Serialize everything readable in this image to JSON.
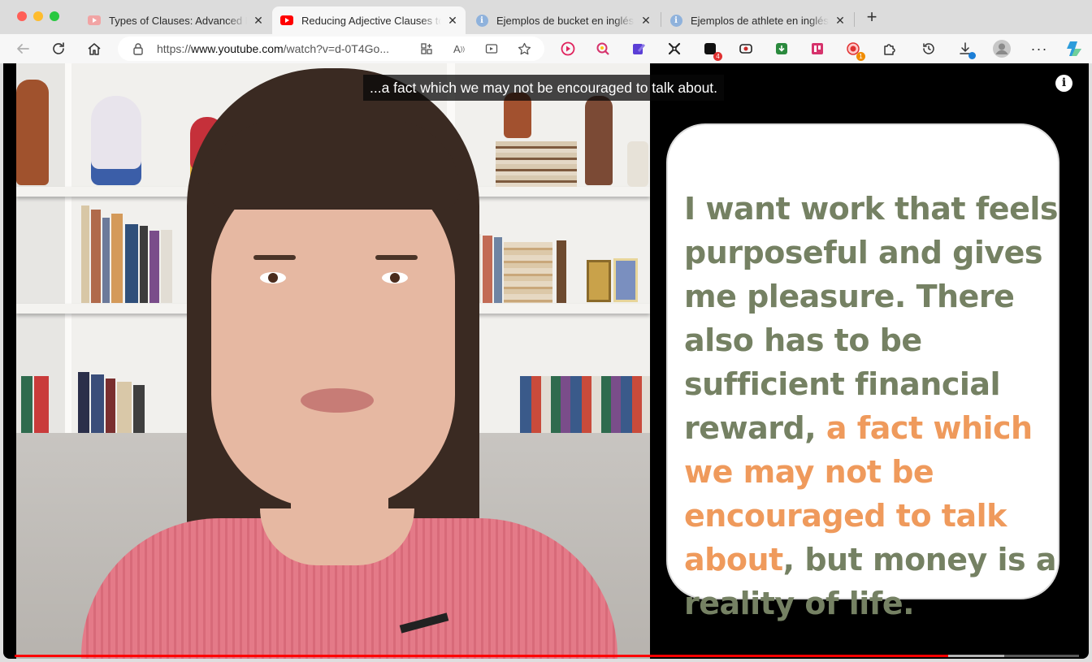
{
  "window": {
    "controls": [
      "close",
      "minimize",
      "maximize"
    ]
  },
  "tabs": [
    {
      "title": "Types of Clauses: Advanced Eng",
      "favicon": "youtube-icon",
      "favicon_color": "#f1a4a4",
      "active": false
    },
    {
      "title": "Reducing Adjective Clauses to Adjective Phrases",
      "favicon": "youtube-icon",
      "favicon_color": "#ff0000",
      "active": true
    },
    {
      "title": "Ejemplos de bucket en inglés | Ejemplos",
      "favicon": "info-icon",
      "active": false
    },
    {
      "title": "Ejemplos de athlete en inglés | Ejemplos",
      "favicon": "info-icon",
      "active": false
    }
  ],
  "toolbar": {
    "url_prefix": "https://",
    "url_domain": "www.youtube.com",
    "url_path": "/watch?v=d-0T4Go...",
    "extensions": [
      {
        "name": "video-extension-icon",
        "color": "#e0245e"
      },
      {
        "name": "zoom-search-extension-icon",
        "color": "#d6336c"
      },
      {
        "name": "note-extension-icon",
        "color": "#5b3fd6"
      },
      {
        "name": "shuffle-extension-icon",
        "color": "#222222"
      },
      {
        "name": "block-extension-icon",
        "color": "#111111",
        "badge": "4",
        "badge_color": "#e03131"
      },
      {
        "name": "record-extension-icon",
        "color": "#c92a2a"
      },
      {
        "name": "download-box-extension-icon",
        "color": "#2b8a3e"
      },
      {
        "name": "board-extension-icon",
        "color": "#d6336c"
      },
      {
        "name": "target-extension-icon",
        "color": "#e03131",
        "badge": "1",
        "badge_color": "#f08c00"
      },
      {
        "name": "puzzle-extension-icon",
        "color": "#333333"
      }
    ],
    "download_badge_color": "#1c7ed6"
  },
  "video": {
    "subtitle": "...a fact which we may not be encouraged to talk about.",
    "info_label": "i",
    "card": {
      "text_before": "I want work that feels purposeful and gives me pleasure. There also has to be sufficient financial reward, ",
      "text_highlight": "a fact which we may not be encouraged to talk about",
      "text_after": ", but money is a reality of life."
    },
    "progress": {
      "played_fraction": 0.877,
      "buffered_fraction": 0.93
    },
    "colors": {
      "text": "#758163",
      "highlight": "#ef9a5c",
      "progress": "#ff0000"
    }
  }
}
